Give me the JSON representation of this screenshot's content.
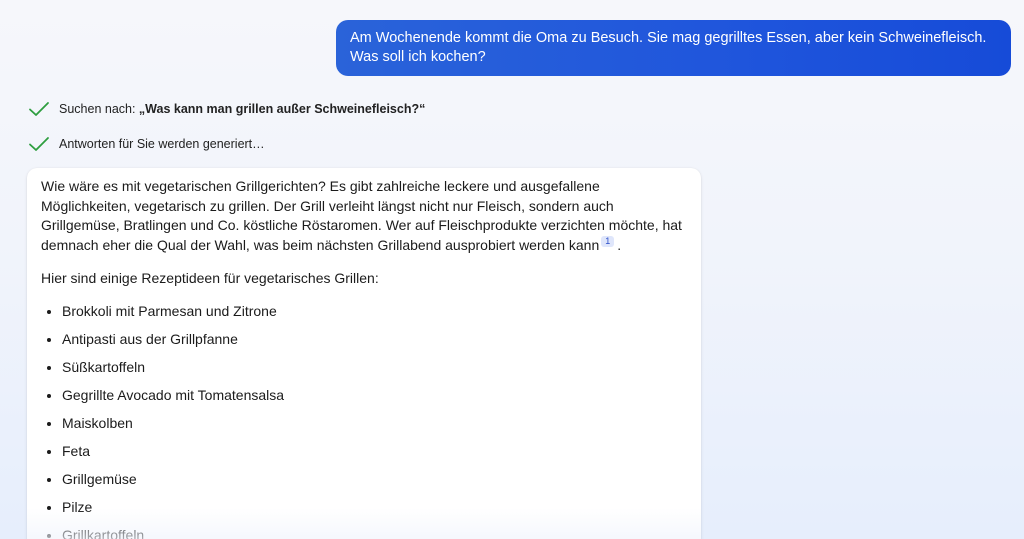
{
  "user_message": "Am Wochenende kommt die Oma zu Besuch. Sie mag gegrilltes Essen, aber kein Schweinefleisch. Was soll ich kochen?",
  "status": {
    "search_prefix": "Suchen nach: ",
    "search_query": "„Was kann man grillen außer Schweinefleisch?“",
    "generating": "Antworten für Sie werden generiert…"
  },
  "answer": {
    "intro": "Wie wäre es mit vegetarischen Grillgerichten? Es gibt zahlreiche leckere und ausgefallene Möglichkeiten, vegetarisch zu grillen. Der Grill verleiht längst nicht nur Fleisch, sondern auch Grillgemüse, Bratlingen und Co. köstliche Röstaromen. Wer auf Fleischprodukte verzichten möchte, hat demnach eher die Qual der Wahl, was beim nächsten Grillabend ausprobiert werden kann",
    "citation": "1",
    "intro_end": ".",
    "list_heading": "Hier sind einige Rezeptideen für vegetarisches Grillen:",
    "items": [
      "Brokkoli mit Parmesan und Zitrone",
      "Antipasti aus der Grillpfanne",
      "Süßkartoffeln",
      "Gegrillte Avocado mit Tomatensalsa",
      "Maiskolben",
      "Feta",
      "Grillgemüse",
      "Pilze",
      "Grillkartoffeln"
    ]
  },
  "colors": {
    "user_bubble": "#1f55dc",
    "check": "#2e9e3f",
    "citation_bg": "#dfe6fb"
  },
  "icons": {
    "status_check": "checkmark-icon"
  }
}
